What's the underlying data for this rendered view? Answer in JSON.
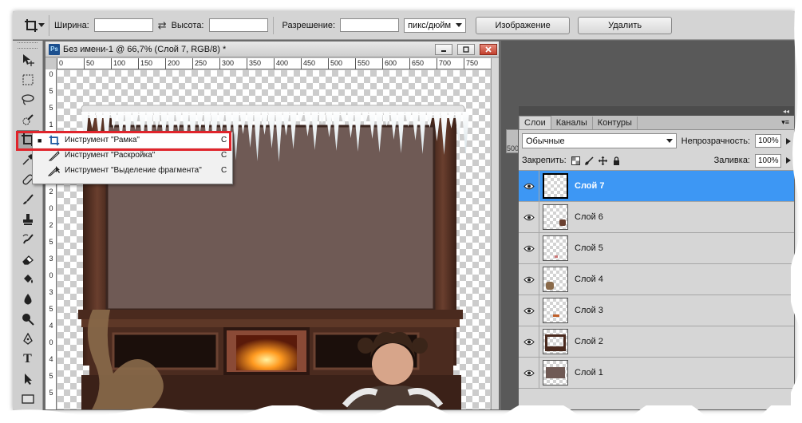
{
  "options_bar": {
    "width_label": "Ширина:",
    "height_label": "Высота:",
    "resolution_label": "Разрешение:",
    "resolution_unit": "пикс/дюйм",
    "image_button": "Изображение",
    "delete_button": "Удалить"
  },
  "document": {
    "title": "Без имени-1 @ 66,7% (Слой 7, RGB/8) *",
    "ps_badge": "Ps",
    "ruler_h": [
      "0",
      "50",
      "100",
      "150",
      "200",
      "250",
      "300",
      "350",
      "400",
      "450",
      "500",
      "550",
      "600",
      "650",
      "700",
      "750"
    ],
    "ruler_v": [
      "0",
      "5",
      "5",
      "1",
      "0",
      "1",
      "5",
      "2",
      "0",
      "2",
      "5",
      "3",
      "0",
      "3",
      "5",
      "4",
      "0",
      "4",
      "5",
      "5"
    ]
  },
  "flyout": {
    "items": [
      {
        "label": "Инструмент \"Рамка\"",
        "key": "C",
        "selected": true,
        "icon": "crop-icon"
      },
      {
        "label": "Инструмент \"Раскройка\"",
        "key": "C",
        "selected": false,
        "icon": "slice-icon"
      },
      {
        "label": "Инструмент \"Выделение фрагмента\"",
        "key": "C",
        "selected": false,
        "icon": "slice-select-icon"
      }
    ]
  },
  "layers_panel": {
    "tabs": [
      "Слои",
      "Каналы",
      "Контуры"
    ],
    "active_tab": "Слои",
    "blend_mode": "Обычные",
    "opacity_label": "Непрозрачность:",
    "opacity_value": "100%",
    "lock_label": "Закрепить:",
    "fill_label": "Заливка:",
    "fill_value": "100%",
    "layers": [
      {
        "name": "Слой 7",
        "selected": true
      },
      {
        "name": "Слой 6",
        "selected": false
      },
      {
        "name": "Слой 5",
        "selected": false
      },
      {
        "name": "Слой 4",
        "selected": false
      },
      {
        "name": "Слой 3",
        "selected": false
      },
      {
        "name": "Слой 2",
        "selected": false
      },
      {
        "name": "Слой 1",
        "selected": false
      }
    ]
  },
  "side_stub_label": "500",
  "colors": {
    "highlight": "#e0252c",
    "selection": "#3d97f4",
    "wall": "#6f5a55",
    "wood": "#4a2a1e"
  }
}
